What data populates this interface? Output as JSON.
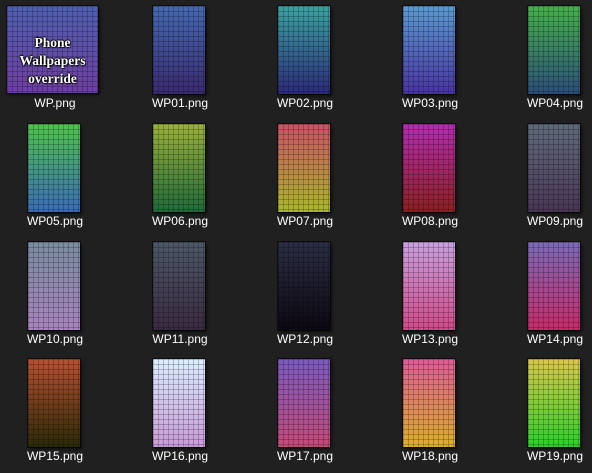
{
  "files": [
    {
      "name": "WP.png",
      "thumb": "square",
      "top": "#4f5fb0",
      "bottom": "#6e3fa0",
      "thumb_text": "Phone Wallpapers\noverride"
    },
    {
      "name": "WP01.png",
      "thumb": "portrait",
      "top": "#4469b0",
      "bottom": "#3a2a70"
    },
    {
      "name": "WP02.png",
      "thumb": "portrait",
      "top": "#3aa2a0",
      "bottom": "#2c2a78"
    },
    {
      "name": "WP03.png",
      "thumb": "portrait",
      "top": "#5a9ad0",
      "bottom": "#4a34a0"
    },
    {
      "name": "WP04.png",
      "thumb": "portrait",
      "top": "#44b04a",
      "bottom": "#2c4e7a"
    },
    {
      "name": "WP05.png",
      "thumb": "portrait",
      "top": "#4ec44a",
      "bottom": "#3a6ab8"
    },
    {
      "name": "WP06.png",
      "thumb": "portrait",
      "top": "#9ab03a",
      "bottom": "#1f6a3a"
    },
    {
      "name": "WP07.png",
      "thumb": "portrait",
      "top": "#cc5066",
      "bottom": "#aab82a"
    },
    {
      "name": "WP08.png",
      "thumb": "portrait",
      "top": "#b42cb0",
      "bottom": "#8a2020"
    },
    {
      "name": "WP09.png",
      "thumb": "portrait",
      "top": "#5e6a7a",
      "bottom": "#4a3656"
    },
    {
      "name": "WP10.png",
      "thumb": "portrait",
      "top": "#7a8c9e",
      "bottom": "#a884c0"
    },
    {
      "name": "WP11.png",
      "thumb": "portrait",
      "top": "#4c5866",
      "bottom": "#3a2a40"
    },
    {
      "name": "WP12.png",
      "thumb": "portrait",
      "top": "#2a2e44",
      "bottom": "#0e0812"
    },
    {
      "name": "WP13.png",
      "thumb": "portrait",
      "top": "#c8a0e0",
      "bottom": "#d04a88"
    },
    {
      "name": "WP14.png",
      "thumb": "portrait",
      "top": "#7a6ab8",
      "bottom": "#c82a6a"
    },
    {
      "name": "WP15.png",
      "thumb": "portrait",
      "top": "#b85030",
      "bottom": "#2a2a08"
    },
    {
      "name": "WP16.png",
      "thumb": "portrait",
      "top": "#dceeff",
      "bottom": "#c89ad8"
    },
    {
      "name": "WP17.png",
      "thumb": "portrait",
      "top": "#7a5ac0",
      "bottom": "#c44a78"
    },
    {
      "name": "WP18.png",
      "thumb": "portrait",
      "top": "#de5a98",
      "bottom": "#dcb028"
    },
    {
      "name": "WP19.png",
      "thumb": "portrait",
      "top": "#dcc84a",
      "bottom": "#2ad02a"
    }
  ]
}
